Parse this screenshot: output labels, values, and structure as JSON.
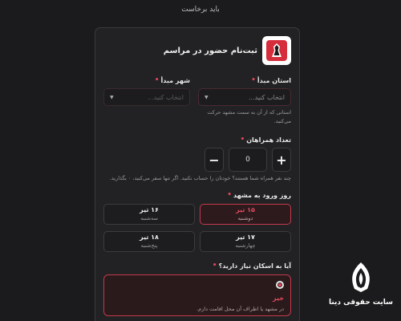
{
  "page": {
    "top_hint": "باید برخاست"
  },
  "header": {
    "title": "ثبت‌نام حضور در مراسم"
  },
  "origin": {
    "province_label": "استان مبدأ",
    "province_placeholder": "انتخاب کنید...",
    "city_label": "شهر مبدأ",
    "city_placeholder": "انتخاب کنید...",
    "help": "استانی که از آن به سمت مشهد حرکت می‌کنید."
  },
  "companions": {
    "label": "تعداد همراهان",
    "value": "0",
    "plus": "+",
    "minus": "−",
    "help": "چند نفر همراه شما هستند؟ خودتان را حساب نکنید. اگر تنها سفر می‌کنید، ۰ بگذارید."
  },
  "arrival": {
    "label": "روز ورود به مشهد",
    "days": [
      {
        "date": "۱۵ تیر",
        "weekday": "دوشنبه",
        "selected": true
      },
      {
        "date": "۱۶ تیر",
        "weekday": "سه‌شنبه",
        "selected": false
      },
      {
        "date": "۱۷ تیر",
        "weekday": "چهارشنبه",
        "selected": false
      },
      {
        "date": "۱۸ تیر",
        "weekday": "پنج‌شنبه",
        "selected": false
      }
    ]
  },
  "stay": {
    "label": "آیا به اسکان نیاز دارید؟",
    "option_title": "خیر",
    "option_desc": "در مشهد یا اطراف آن محل اقامت دارم."
  },
  "watermark": {
    "text": "سایت حقوقی دینا"
  },
  "colors": {
    "accent": "#e24a5d",
    "background": "#1b1b1d",
    "card": "#222224"
  }
}
